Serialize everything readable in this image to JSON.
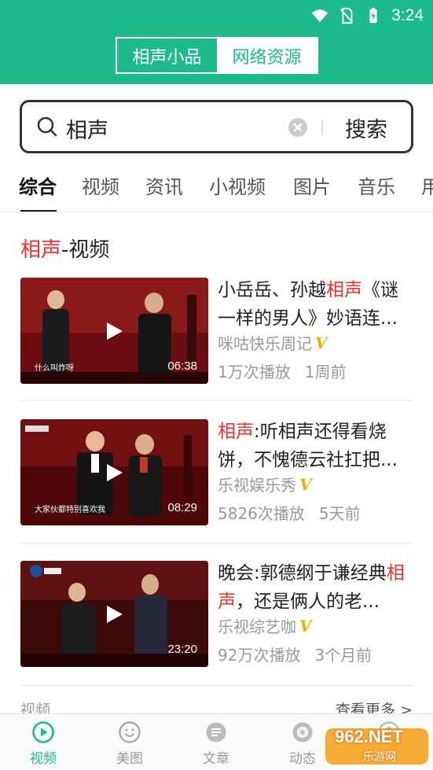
{
  "status_bar": {
    "time": "3:24",
    "icons": [
      "wifi-icon",
      "no-sim-icon",
      "battery-charging-icon"
    ]
  },
  "header": {
    "tabs": [
      {
        "label": "相声小品",
        "active": true
      },
      {
        "label": "网络资源",
        "active": false
      }
    ]
  },
  "search": {
    "value": "相声",
    "button_label": "搜索"
  },
  "category_tabs": [
    "综合",
    "视频",
    "资讯",
    "小视频",
    "图片",
    "音乐",
    "用"
  ],
  "section": {
    "highlight": "相声",
    "title": "-视频"
  },
  "videos": [
    {
      "title_pre": "小岳岳、孙越",
      "title_hl": "相声",
      "title_post": "《谜一样的男人》妙语连...",
      "source": "咪咕快乐周记",
      "plays": "1万次播放",
      "time": "1周前",
      "duration": "06:38",
      "caption": "什么叫炸呀"
    },
    {
      "title_pre": "",
      "title_hl": "相声",
      "title_post": ":听相声还得看烧饼，不愧德云社扛把...",
      "source": "乐视娱乐秀",
      "plays": "5826次播放",
      "time": "5天前",
      "duration": "08:29",
      "caption": "大家伙都特别喜欢我"
    },
    {
      "title_pre": "晚会:郭德纲于谦经典",
      "title_hl": "相声",
      "title_post": "，还是俩人的老...",
      "source": "乐视综艺咖",
      "plays": "92万次播放",
      "time": "3个月前",
      "duration": "23:20",
      "caption": ""
    }
  ],
  "more_row": {
    "left": "视频",
    "right": "查看更多 >"
  },
  "bottom_nav": [
    {
      "label": "视频",
      "icon": "play-circle-icon",
      "active": true
    },
    {
      "label": "美图",
      "icon": "smile-face-icon",
      "active": false
    },
    {
      "label": "文章",
      "icon": "article-icon",
      "active": false
    },
    {
      "label": "动态",
      "icon": "camera-aperture-icon",
      "active": false
    },
    {
      "label": "",
      "icon": "profile-icon",
      "active": false
    }
  ],
  "watermark": {
    "text": "962.NET",
    "sub": "乐游网"
  },
  "colors": {
    "brand": "#1dba8c",
    "highlight": "#e8322e",
    "vip": "#e5b300"
  }
}
